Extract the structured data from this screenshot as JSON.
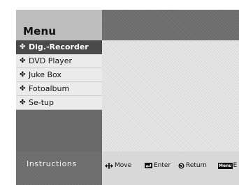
{
  "header": {
    "title": "Menu"
  },
  "menu": {
    "items": [
      {
        "label": "Dig.-Recorder",
        "selected": true
      },
      {
        "label": "DVD Player",
        "selected": false
      },
      {
        "label": "Juke Box",
        "selected": false
      },
      {
        "label": "Fotoalbum",
        "selected": false
      },
      {
        "label": "Se-tup",
        "selected": false
      }
    ],
    "bullet_icon": "diamond-bullet-icon"
  },
  "footer": {
    "instructions_label": "Instructions",
    "hints": {
      "move": {
        "icon": "four-way-arrow-icon",
        "label": "Move"
      },
      "enter": {
        "icon": "enter-key-icon",
        "label": "Enter"
      },
      "return": {
        "icon": "return-circle-icon",
        "label": "Return"
      },
      "menu": {
        "key_label": "Menu",
        "label": "E"
      }
    }
  },
  "colors": {
    "selected_bg": "#4a4a4a",
    "title_bar_right": "#6c6c6c",
    "menu_item_bg": "#ebebeb",
    "instructions_bg": "#6c6c6c"
  }
}
